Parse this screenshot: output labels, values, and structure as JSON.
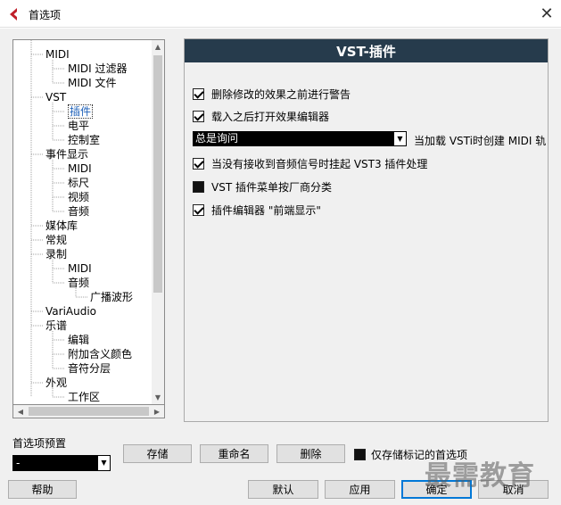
{
  "window": {
    "title": "首选项",
    "close_symbol": "✕"
  },
  "tree": {
    "items": [
      {
        "label": "MIDI",
        "level": 1
      },
      {
        "label": "MIDI 过滤器",
        "level": 2
      },
      {
        "label": "MIDI 文件",
        "level": 2
      },
      {
        "label": "VST",
        "level": 1
      },
      {
        "label": "插件",
        "level": 2,
        "selected": true
      },
      {
        "label": "电平",
        "level": 2
      },
      {
        "label": "控制室",
        "level": 2
      },
      {
        "label": "事件显示",
        "level": 1
      },
      {
        "label": "MIDI",
        "level": 2
      },
      {
        "label": "标尺",
        "level": 2
      },
      {
        "label": "视频",
        "level": 2
      },
      {
        "label": "音频",
        "level": 2
      },
      {
        "label": "媒体库",
        "level": 1
      },
      {
        "label": "常规",
        "level": 1
      },
      {
        "label": "录制",
        "level": 1
      },
      {
        "label": "MIDI",
        "level": 2
      },
      {
        "label": "音频",
        "level": 2
      },
      {
        "label": "广播波形",
        "level": 3
      },
      {
        "label": "VariAudio",
        "level": 1
      },
      {
        "label": "乐谱",
        "level": 1
      },
      {
        "label": "编辑",
        "level": 2
      },
      {
        "label": "附加含义颜色",
        "level": 2
      },
      {
        "label": "音符分层",
        "level": 2
      },
      {
        "label": "外观",
        "level": 1
      },
      {
        "label": "工作区",
        "level": 2
      }
    ]
  },
  "panel": {
    "title": "VST-插件",
    "options": [
      {
        "label": "删除修改的效果之前进行警告",
        "state": "checked"
      },
      {
        "label": "载入之后打开效果编辑器",
        "state": "checked"
      },
      {
        "label": "当没有接收到音频信号时挂起 VST3 插件处理",
        "state": "checked"
      },
      {
        "label": "VST 插件菜单按厂商分类",
        "state": "filled"
      },
      {
        "label": "插件编辑器 \"前端显示\"",
        "state": "checked"
      }
    ],
    "combo": {
      "value": "总是询问",
      "label": "当加载 VSTi时创建 MIDI 轨"
    }
  },
  "presets": {
    "label": "首选项预置",
    "value": "-",
    "store": "存储",
    "rename": "重命名",
    "delete": "删除",
    "store_marked": "仅存储标记的首选项"
  },
  "footer": {
    "help": "帮助",
    "defaults": "默认",
    "apply": "应用",
    "ok": "确定",
    "cancel": "取消"
  },
  "watermark": "最需教育",
  "colors": {
    "header_bg": "#263b4c",
    "selected_text": "#1c5fb8",
    "app_icon": "#c0202a"
  }
}
